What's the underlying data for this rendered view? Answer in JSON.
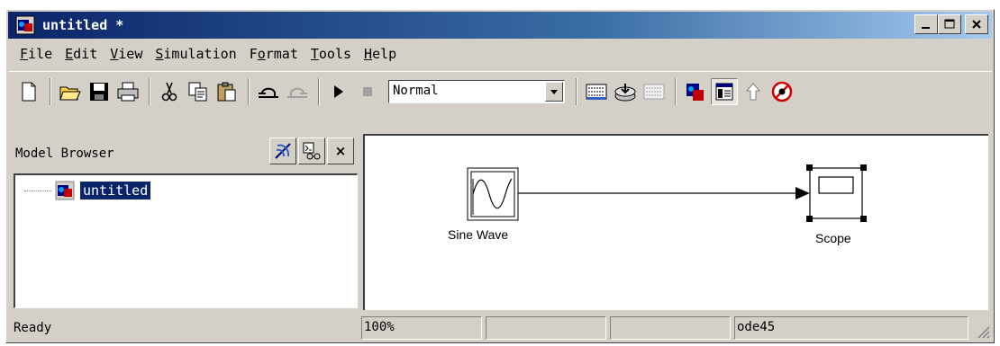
{
  "window": {
    "title": "untitled *"
  },
  "menu": {
    "items": [
      {
        "label": "File",
        "u": "F",
        "rest": "ile"
      },
      {
        "label": "Edit",
        "u": "E",
        "rest": "dit"
      },
      {
        "label": "View",
        "u": "V",
        "rest": "iew"
      },
      {
        "label": "Simulation",
        "u": "S",
        "rest": "imulation"
      },
      {
        "label": "Format",
        "pre": "F",
        "u": "o",
        "rest": "rmat"
      },
      {
        "label": "Tools",
        "u": "T",
        "rest": "ools"
      },
      {
        "label": "Help",
        "u": "H",
        "rest": "elp"
      }
    ]
  },
  "toolbar": {
    "simulation_mode": "Normal"
  },
  "browser": {
    "title": "Model Browser",
    "tree_item": "untitled"
  },
  "canvas": {
    "blocks": [
      {
        "name": "sine-wave-block",
        "label": "Sine Wave"
      },
      {
        "name": "scope-block",
        "label": "Scope"
      }
    ]
  },
  "status": {
    "ready": "Ready",
    "zoom": "100%",
    "cell2": "",
    "cell3": "",
    "solver": "ode45"
  },
  "colors": {
    "title_start": "#0a246a",
    "title_end": "#a6caf0",
    "selection": "#0a246a",
    "chrome": "#d4d0c8"
  }
}
